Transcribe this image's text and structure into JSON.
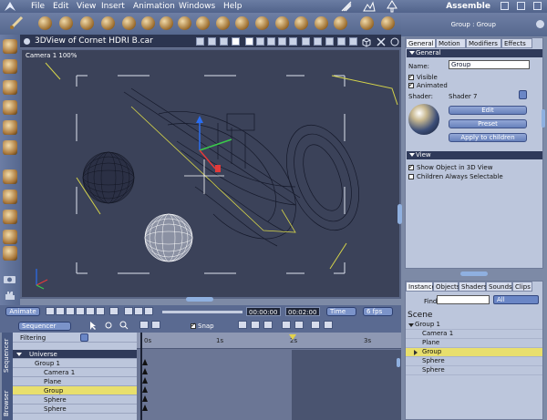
{
  "menubar": {
    "items": [
      "File",
      "Edit",
      "View",
      "Insert",
      "Animation",
      "Windows",
      "Help"
    ],
    "app_title": "Assemble"
  },
  "viewport": {
    "title": "3DView of Cornet HDRI B.car",
    "camera_label": "Camera 1 100%"
  },
  "properties": {
    "window_title": "Group : Group",
    "tabs": [
      "General",
      "Motion",
      "Modifiers",
      "Effects"
    ],
    "general_section": "General",
    "name_label": "Name:",
    "name_value": "Group",
    "visible_label": "Visible",
    "animated_label": "Animated",
    "shader_label": "Shader:",
    "shader_value": "Shader 7",
    "edit_button": "Edit",
    "preset_button": "Preset",
    "apply_button": "Apply to children",
    "view_section": "View",
    "show_object_label": "Show Object in 3D View",
    "children_selectable_label": "Children Always Selectable"
  },
  "scene_panel": {
    "tabs": [
      "Instance",
      "Objects",
      "Shaders",
      "Sounds",
      "Clips"
    ],
    "find_label": "Find:",
    "find_value": "",
    "filter_value": "All",
    "heading": "Scene",
    "tree": [
      {
        "label": "Group 1",
        "level": 0,
        "selected": false
      },
      {
        "label": "Camera 1",
        "level": 1,
        "selected": false
      },
      {
        "label": "Plane",
        "level": 1,
        "selected": false
      },
      {
        "label": "Group",
        "level": 1,
        "selected": true
      },
      {
        "label": "Sphere",
        "level": 1,
        "selected": false
      },
      {
        "label": "Sphere",
        "level": 1,
        "selected": false
      }
    ]
  },
  "transport": {
    "animate_label": "Animate",
    "current_time": "00:00:00",
    "end_time": "00:02:00",
    "time_mode": "Time",
    "fps": "6 fps"
  },
  "sequencer": {
    "mode": "Sequencer",
    "snap_label": "Snap",
    "filtering_label": "Filtering",
    "side_tabs": [
      "Sequencer",
      "Browser"
    ],
    "tree": [
      {
        "label": "Universe",
        "selected": false
      },
      {
        "label": "Group 1",
        "selected": false
      },
      {
        "label": "Camera 1",
        "selected": false
      },
      {
        "label": "Plane",
        "selected": false
      },
      {
        "label": "Group",
        "selected": true
      },
      {
        "label": "Sphere",
        "selected": false
      },
      {
        "label": "Sphere",
        "selected": false
      }
    ],
    "ruler_labels": [
      "0s",
      "1s",
      "2s",
      "3s"
    ]
  }
}
